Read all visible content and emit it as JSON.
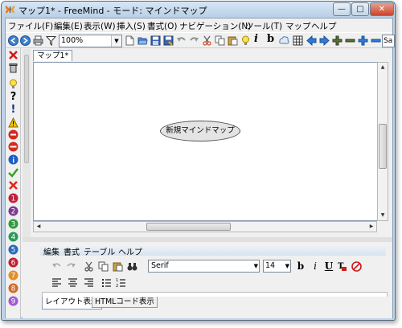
{
  "window": {
    "title": "マップ1* - FreeMind - モード: マインドマップ",
    "minimize": "—",
    "maximize": "□",
    "close": "✕"
  },
  "menubar": [
    {
      "label": "ファイル(F)"
    },
    {
      "label": "編集(E)"
    },
    {
      "label": "表示(W)"
    },
    {
      "label": "挿入(S)"
    },
    {
      "label": "書式(O)"
    },
    {
      "label": "ナビゲーション(N)"
    },
    {
      "label": "ツール(T)"
    },
    {
      "label": "マップ"
    },
    {
      "label": "ヘルプ"
    }
  ],
  "toolbar": {
    "zoom_value": "100%",
    "search_value": "Sa"
  },
  "map": {
    "tab_label": "マップ1*",
    "root_node_text": "新規マインドマップ"
  },
  "editor": {
    "menu": [
      "編集",
      "書式",
      "テーブル",
      "ヘルプ"
    ],
    "font_family": "Serif",
    "font_size": "14",
    "tabs": [
      "レイアウト表示",
      "HTMLコード表示"
    ]
  },
  "icons": {
    "left_toolbar": [
      "delete-x-icon",
      "trash-icon",
      "idea-bulb-icon",
      "question-icon",
      "exclamation-icon",
      "warning-icon",
      "stop-icon",
      "stop-sign-icon",
      "info-icon",
      "check-icon",
      "cross-icon",
      "priority-1-icon",
      "priority-2-icon",
      "priority-3-icon",
      "priority-4-icon",
      "priority-5-icon",
      "priority-6-icon",
      "priority-7-icon",
      "priority-8-icon",
      "priority-9-icon"
    ]
  },
  "colors": {
    "titlebar": "#bfd2e8",
    "canvas": "#ffffff",
    "node_fill": "#e4e4e4",
    "close_button": "#c8452e"
  }
}
